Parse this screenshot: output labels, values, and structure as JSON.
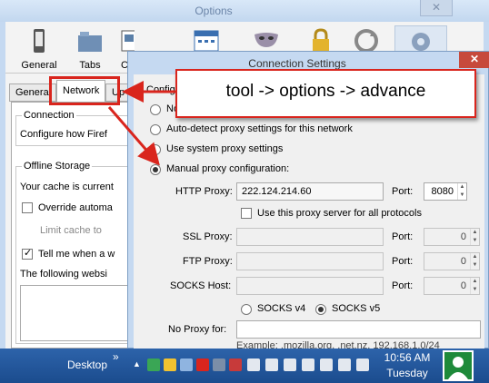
{
  "options_window": {
    "title": "Options",
    "close_glyph": "✕",
    "toolbar": [
      {
        "label": "General",
        "icon": "phone-icon"
      },
      {
        "label": "Tabs",
        "icon": "folder-tabs-icon"
      },
      {
        "label": "C",
        "icon": "content-icon"
      },
      {
        "label": "",
        "icon": "calendar-icon"
      },
      {
        "label": "",
        "icon": "privacy-mask-icon"
      },
      {
        "label": "",
        "icon": "padlock-icon"
      },
      {
        "label": "",
        "icon": "sync-icon"
      },
      {
        "label": "",
        "icon": "gear-icon"
      }
    ],
    "tabs": [
      "General",
      "Network",
      "Up"
    ],
    "connection": {
      "title": "Connection",
      "text": "Configure how Firef"
    },
    "offline": {
      "title": "Offline Storage",
      "cache_text": "Your cache is current",
      "override_label": "Override automa",
      "limit_label": "Limit cache to",
      "tell_label": "Tell me when a w",
      "following_text": "The following websi"
    }
  },
  "connection_settings": {
    "title": "Connection Settings",
    "close_glyph": "✕",
    "config_heading": "Config",
    "radio_no_proxy": "No",
    "radio_auto": "Auto-detect proxy settings for this network",
    "radio_system": "Use system proxy settings",
    "radio_manual": "Manual proxy configuration:",
    "http_label": "HTTP Proxy:",
    "http_value": "222.124.214.60",
    "port_label": "Port:",
    "http_port": "8080",
    "use_all_label": "Use this proxy server for all protocols",
    "ssl_label": "SSL Proxy:",
    "ssl_port": "0",
    "ftp_label": "FTP Proxy:",
    "ftp_port": "0",
    "socks_label": "SOCKS Host:",
    "socks_port": "0",
    "socks4_label": "SOCKS v4",
    "socks5_label": "SOCKS v5",
    "noproxy_label": "No Proxy for:",
    "example_text": "Example: .mozilla.org, .net.nz, 192.168.1.0/24"
  },
  "annotation": {
    "note": "tool -> options -> advance",
    "color": "#d9251d"
  },
  "taskbar": {
    "desktop_label": "Desktop",
    "chevron": "»",
    "tray_up": "▲",
    "time": "10:56 AM",
    "day": "Tuesday"
  }
}
